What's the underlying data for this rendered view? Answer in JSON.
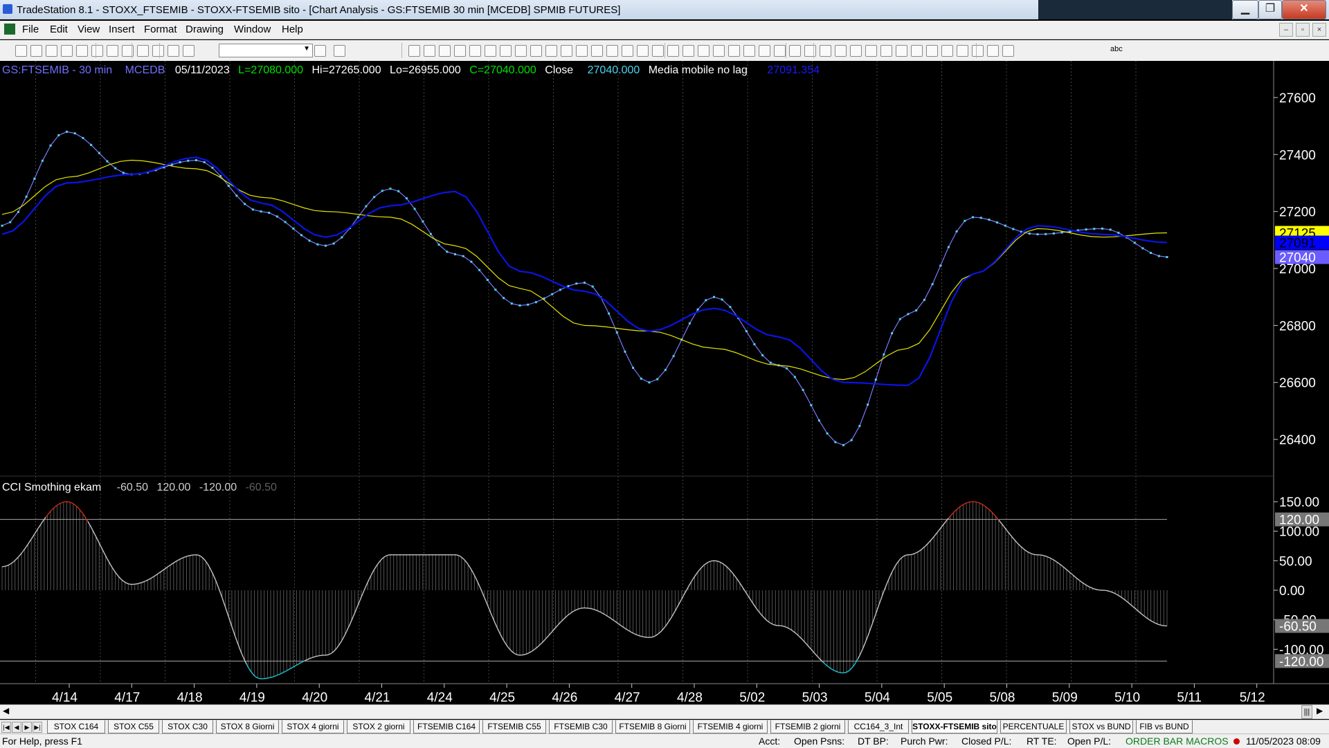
{
  "window": {
    "title": "TradeStation 8.1 - STOXX_FTSEMIB - STOXX-FTSEMIB sito - [Chart Analysis - GS:FTSEMIB  30 min  [MCEDB] SPMIB FUTURES]",
    "buttons": {
      "minimize": "▁",
      "maximize": "❐",
      "close": "✕"
    }
  },
  "menu": {
    "items": [
      "File",
      "Edit",
      "View",
      "Insert",
      "Format",
      "Drawing",
      "Window",
      "Help"
    ],
    "mdi_buttons": [
      "–",
      "▫",
      "×"
    ]
  },
  "toolbar": {
    "combo_value": "",
    "icons": [
      "new-doc-icon",
      "open-icon",
      "save-icon",
      "save-all-icon",
      "folder-icon",
      "print-icon",
      "print-preview-icon",
      "workspace-icon",
      "workspace-2-icon",
      "lock-icon",
      "drawing-icon",
      "globe-icon",
      "combo-next-icon",
      "search-icon",
      "layout-1-icon",
      "layout-2-icon",
      "layout-3-icon",
      "chart-1-icon",
      "chart-2-icon",
      "chart-3-icon",
      "chart-4-icon",
      "chart-5-icon",
      "chart-6-icon",
      "chart-7-icon",
      "chart-8-icon",
      "chart-9-icon",
      "chart-10-icon",
      "expand-icon",
      "compress-icon",
      "zoom-in-icon",
      "zoom-out-icon",
      "pointer-icon",
      "cursor-data-icon",
      "tools-icon",
      "data-window-icon",
      "disabled-icon",
      "trendline-icon",
      "hlines-icon",
      "vlines-icon",
      "channel-icon",
      "fib-icon",
      "arc-icon",
      "andrews-icon",
      "speed-icon",
      "arrow-icon",
      "double-arrow-icon",
      "parallel-icon",
      "ellipse-arc-icon",
      "pencil-icon",
      "curve-icon",
      "arrow-down-icon",
      "arrow-up-icon",
      "circle-icon",
      "rectangle-icon",
      "text-abc-icon"
    ],
    "text_tool_label": "abc"
  },
  "chart": {
    "header": {
      "symbol": "GS:FTSEMIB - 30 min",
      "dataset": "MCEDB",
      "date": "05/11/2023",
      "last": "L=27080.000",
      "high": "Hi=27265.000",
      "low": "Lo=26955.000",
      "close": "C=27040.000",
      "close_label": "Close",
      "close_value": "27040.000",
      "ma_label": "Media mobile no lag",
      "ma_value": "27091.354"
    },
    "price_axis": {
      "labels": [
        "27600",
        "27400",
        "27200",
        "27000",
        "26800",
        "26600",
        "26400"
      ],
      "markers": [
        {
          "text": "27125",
          "color": "#ffff00",
          "text_color": "#000000"
        },
        {
          "text": "27091",
          "color": "#0000ff",
          "text_color": "#000000"
        },
        {
          "text": "27040",
          "color": "#6a5cff",
          "text_color": "#ffffff"
        }
      ]
    },
    "indicator": {
      "label": "CCI Smothing ekam",
      "values": [
        "-60.50",
        "120.00",
        "-120.00",
        "-60.50"
      ],
      "axis_labels": [
        "150.00",
        "100.00",
        "50.00",
        "0.00",
        "-50.00",
        "-100.00"
      ],
      "markers": [
        "120.00",
        "-60.50",
        "-120.00"
      ]
    },
    "date_axis": [
      "4/14",
      "4/17",
      "4/18",
      "4/19",
      "4/20",
      "4/21",
      "4/24",
      "4/25",
      "4/26",
      "4/27",
      "4/28",
      "5/02",
      "5/03",
      "5/04",
      "5/05",
      "5/08",
      "5/09",
      "5/10",
      "5/11",
      "5/12"
    ],
    "colors": {
      "price": "#4fd3ee",
      "price_line": "#7a7aff",
      "fast_ma": "#0a14e6",
      "slow_ma": "#e6e600",
      "cci": "#c8c8c8",
      "cci_high": "#d42a1a",
      "cci_low": "#20c8d8"
    }
  },
  "chart_data": [
    {
      "type": "line",
      "title": "GS:FTSEMIB - 30 min",
      "xlabel": "",
      "ylabel": "",
      "ylim": [
        26320,
        27680
      ],
      "grid": false,
      "x": [
        "4/14",
        "4/17",
        "4/18",
        "4/19",
        "4/20",
        "4/21",
        "4/24",
        "4/25",
        "4/26",
        "4/27",
        "4/28",
        "5/02",
        "5/03",
        "5/04",
        "5/05",
        "5/08",
        "5/09",
        "5/10",
        "5/11"
      ],
      "series": [
        {
          "name": "Close",
          "values": [
            27150,
            27480,
            27330,
            27380,
            27200,
            27080,
            27280,
            27050,
            26870,
            26950,
            26600,
            26900,
            26660,
            26380,
            26840,
            27180,
            27120,
            27140,
            27040
          ]
        },
        {
          "name": "",
          "values": [
            27120,
            27300,
            27330,
            27390,
            27230,
            27110,
            27220,
            27270,
            26990,
            26920,
            26780,
            26860,
            26760,
            26600,
            26590,
            26980,
            27150,
            27120,
            27091
          ]
        },
        {
          "name": "Media mobile no lag",
          "values": [
            27190,
            27320,
            27380,
            27350,
            27250,
            27200,
            27180,
            27080,
            26930,
            26800,
            26780,
            26720,
            26660,
            26610,
            26720,
            26980,
            27140,
            27110,
            27125
          ]
        }
      ]
    },
    {
      "type": "bar",
      "title": "CCI Smothing ekam",
      "xlabel": "",
      "ylabel": "",
      "ylim": [
        -170,
        170
      ],
      "grid": false,
      "reference_lines": [
        120,
        -120
      ],
      "categories": [
        "4/14",
        "4/17",
        "4/18",
        "4/19",
        "4/20",
        "4/21",
        "4/24",
        "4/25",
        "4/26",
        "4/27",
        "4/28",
        "5/02",
        "5/03",
        "5/04",
        "5/05",
        "5/08",
        "5/09",
        "5/10",
        "5/11"
      ],
      "values": [
        40,
        150,
        10,
        60,
        -150,
        -110,
        60,
        60,
        -110,
        -30,
        -80,
        50,
        -60,
        -140,
        60,
        150,
        60,
        0,
        -60.5
      ]
    }
  ],
  "sheet_tabs": {
    "items": [
      "STOX C164",
      "STOX C55",
      "STOX  C30",
      "STOX  8 Giorni",
      "STOX 4 giorni",
      "STOX  2 giorni",
      "FTSEMIB C164",
      "FTSEMIB C55",
      "FTSEMIB C30",
      "FTSEMIB  8 Giorni",
      "FTSEMIB  4 giorni",
      "FTSEMIB  2 giorni",
      "CC164_3_Int",
      "STOXX-FTSEMIB sito",
      "PERCENTUALE",
      "STOX vs BUND",
      "FIB vs BUND"
    ],
    "active": "STOXX-FTSEMIB sito"
  },
  "status": {
    "help": "For Help, press F1",
    "acct": "Acct:",
    "open_psns": "Open Psns:",
    "dt_bp": "DT BP:",
    "purch_pwr": "Purch Pwr:",
    "closed_pl": "Closed P/L:",
    "rt_te": "RT TE:",
    "open_pl": "Open P/L:",
    "macros": "ORDER BAR  MACROS",
    "datetime": "11/05/2023 08:09"
  }
}
